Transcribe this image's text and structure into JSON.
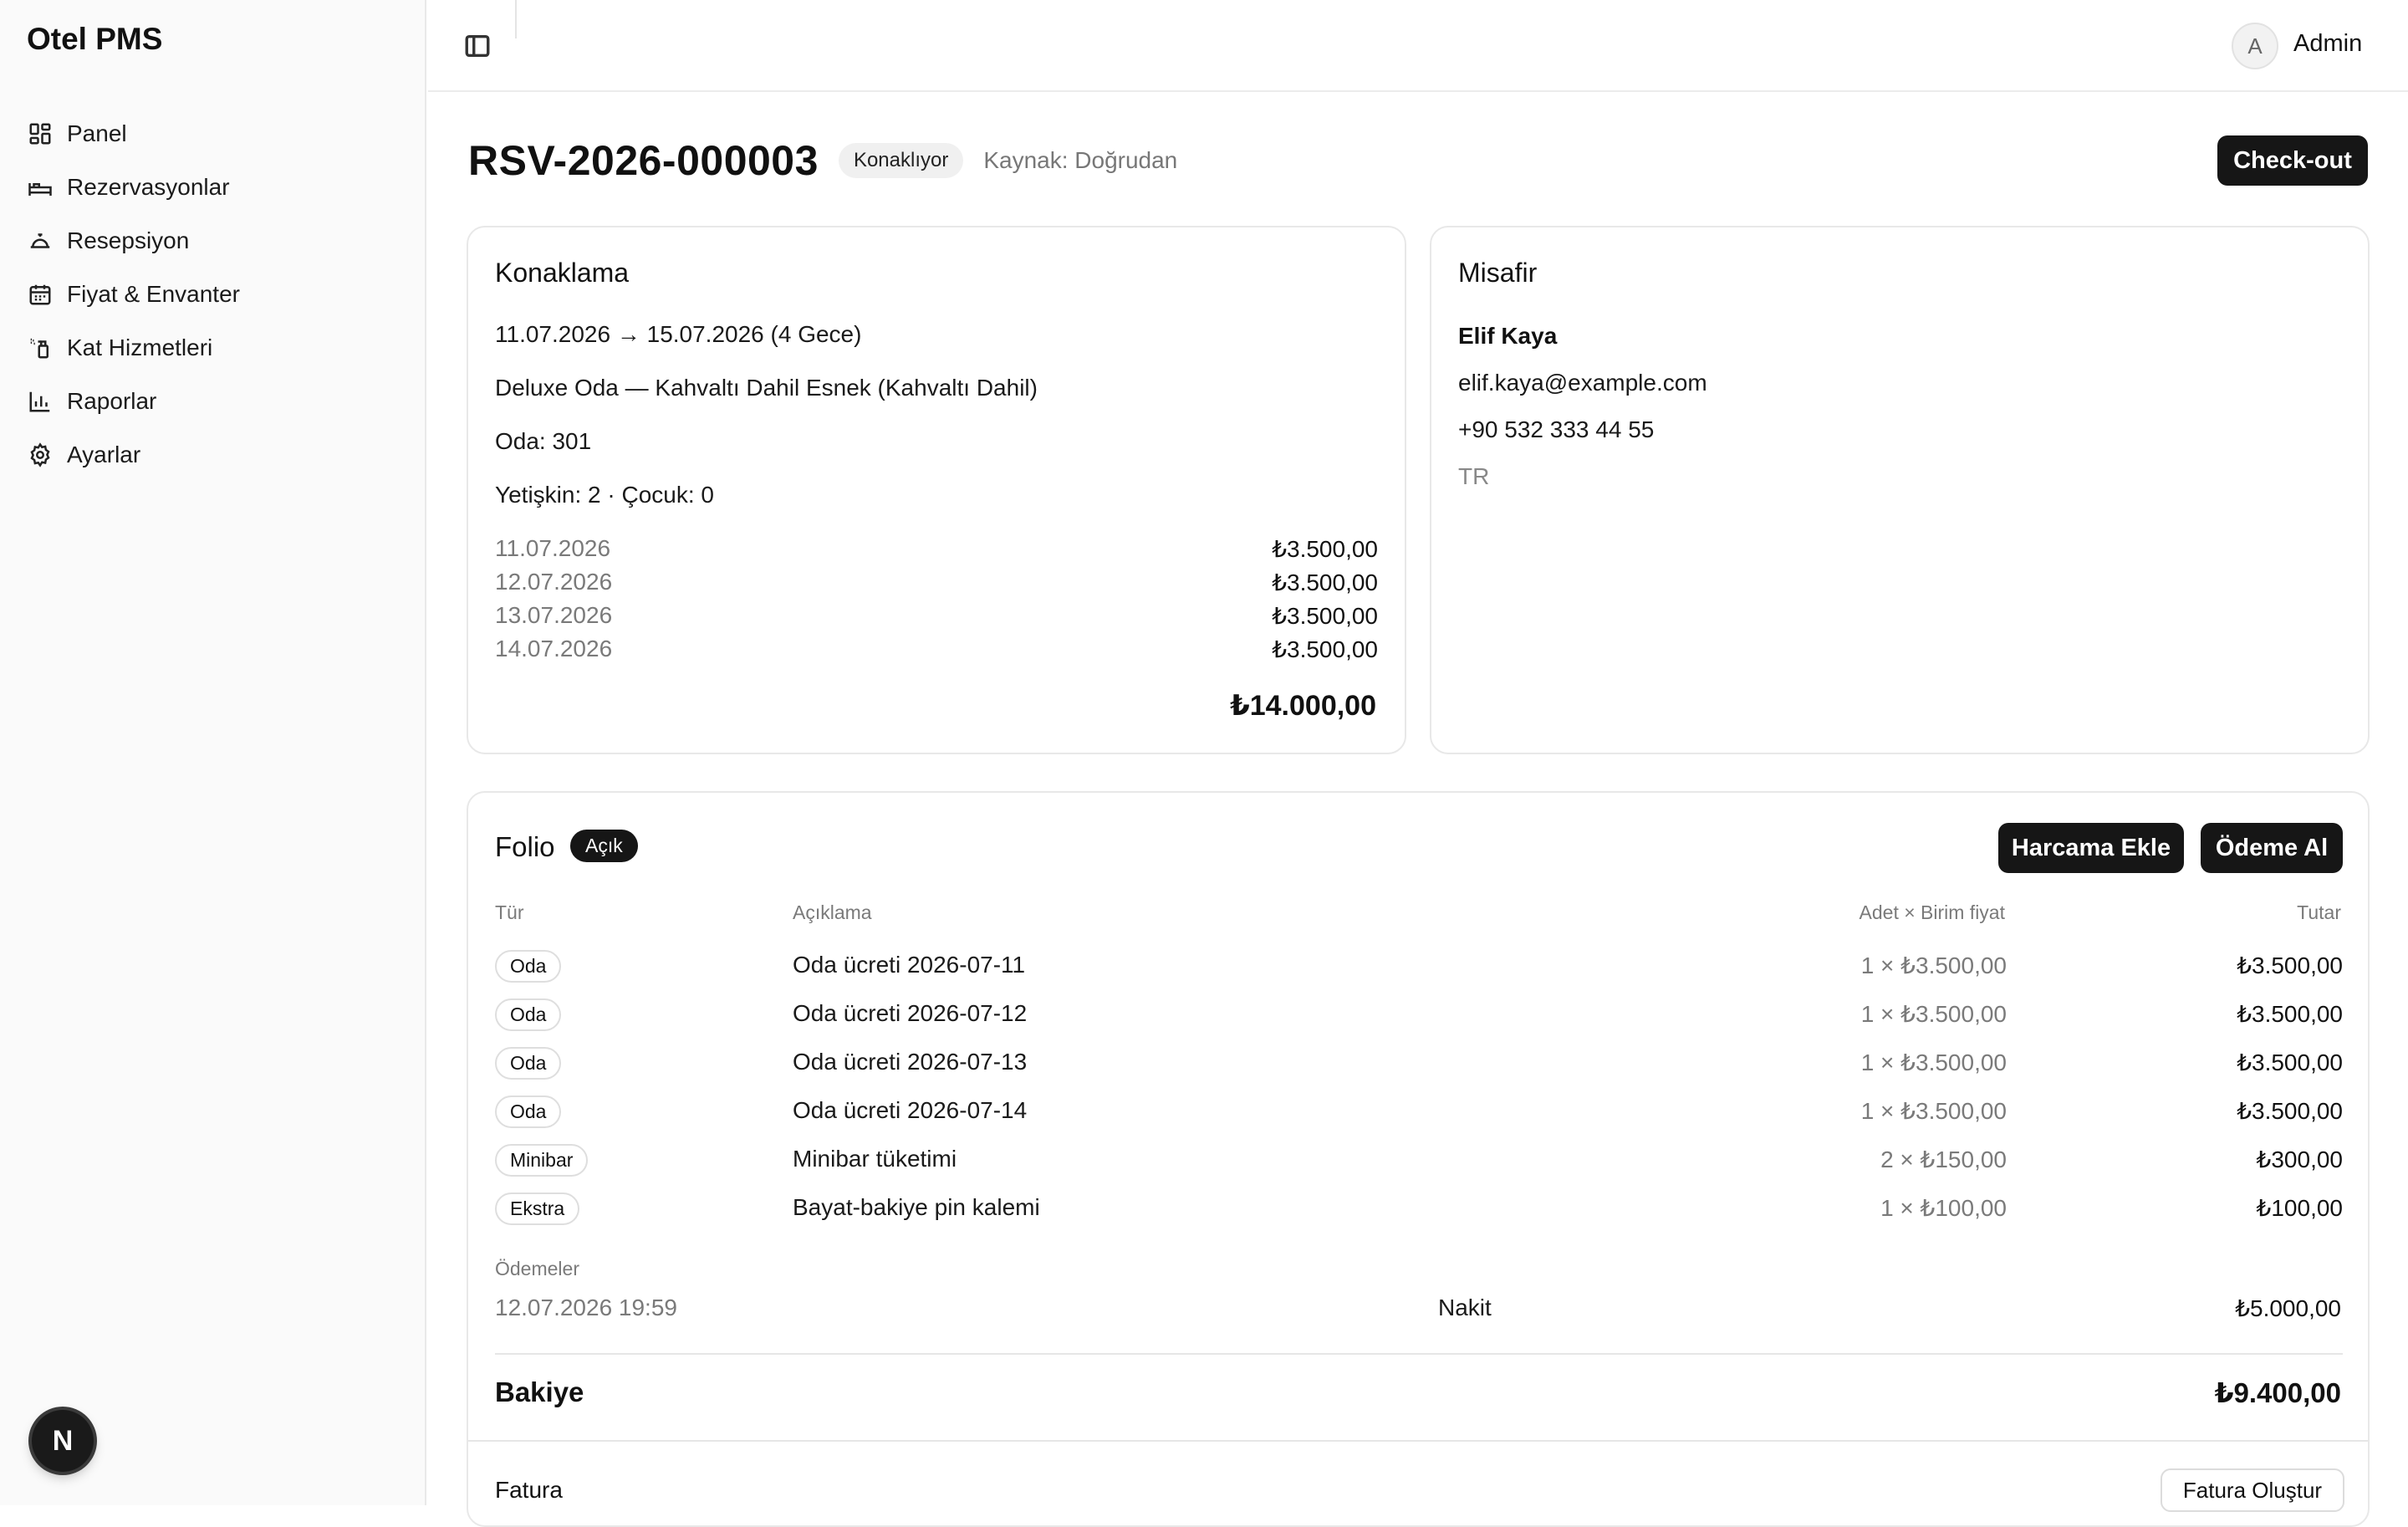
{
  "app": {
    "title": "Otel PMS"
  },
  "sidebar": {
    "items": [
      {
        "label": "Panel",
        "icon": "dashboard-icon"
      },
      {
        "label": "Rezervasyonlar",
        "icon": "bed-icon"
      },
      {
        "label": "Resepsiyon",
        "icon": "bell-icon"
      },
      {
        "label": "Fiyat & Envanter",
        "icon": "calendar-icon"
      },
      {
        "label": "Kat Hizmetleri",
        "icon": "spray-bottle-icon"
      },
      {
        "label": "Raporlar",
        "icon": "bar-chart-icon"
      },
      {
        "label": "Ayarlar",
        "icon": "gear-icon"
      }
    ],
    "bottom_badge": "N"
  },
  "header": {
    "user": {
      "initial": "A",
      "name": "Admin"
    }
  },
  "reservation": {
    "id": "RSV-2026-000003",
    "status": "Konaklıyor",
    "source": "Kaynak: Doğrudan",
    "checkout_label": "Check-out"
  },
  "stay": {
    "title": "Konaklama",
    "dates": "11.07.2026 → 15.07.2026 (4 Gece)",
    "room_type": "Deluxe Oda — Kahvaltı Dahil Esnek (Kahvaltı Dahil)",
    "room": "Oda: 301",
    "occupancy": "Yetişkin: 2 · Çocuk: 0",
    "nights": [
      {
        "date": "11.07.2026",
        "price": "₺3.500,00"
      },
      {
        "date": "12.07.2026",
        "price": "₺3.500,00"
      },
      {
        "date": "13.07.2026",
        "price": "₺3.500,00"
      },
      {
        "date": "14.07.2026",
        "price": "₺3.500,00"
      }
    ],
    "total": "₺14.000,00"
  },
  "guest": {
    "title": "Misafir",
    "name": "Elif Kaya",
    "email": "elif.kaya@example.com",
    "phone": "+90 532 333 44 55",
    "country": "TR"
  },
  "folio": {
    "title": "Folio",
    "status": "Açık",
    "add_charge_label": "Harcama Ekle",
    "take_payment_label": "Ödeme Al",
    "columns": {
      "type": "Tür",
      "description": "Açıklama",
      "qty_price": "Adet × Birim fiyat",
      "amount": "Tutar"
    },
    "rows": [
      {
        "type": "Oda",
        "description": "Oda ücreti 2026-07-11",
        "qty_price": "1 × ₺3.500,00",
        "amount": "₺3.500,00"
      },
      {
        "type": "Oda",
        "description": "Oda ücreti 2026-07-12",
        "qty_price": "1 × ₺3.500,00",
        "amount": "₺3.500,00"
      },
      {
        "type": "Oda",
        "description": "Oda ücreti 2026-07-13",
        "qty_price": "1 × ₺3.500,00",
        "amount": "₺3.500,00"
      },
      {
        "type": "Oda",
        "description": "Oda ücreti 2026-07-14",
        "qty_price": "1 × ₺3.500,00",
        "amount": "₺3.500,00"
      },
      {
        "type": "Minibar",
        "description": "Minibar tüketimi",
        "qty_price": "2 × ₺150,00",
        "amount": "₺300,00"
      },
      {
        "type": "Ekstra",
        "description": "Bayat-bakiye pin kalemi",
        "qty_price": "1 × ₺100,00",
        "amount": "₺100,00"
      }
    ],
    "payments_label": "Ödemeler",
    "payment": {
      "date": "12.07.2026 19:59",
      "method": "Nakit",
      "amount": "₺5.000,00"
    },
    "balance_label": "Bakiye",
    "balance": "₺9.400,00",
    "invoice_label": "Fatura",
    "invoice_button": "Fatura Oluştur"
  }
}
